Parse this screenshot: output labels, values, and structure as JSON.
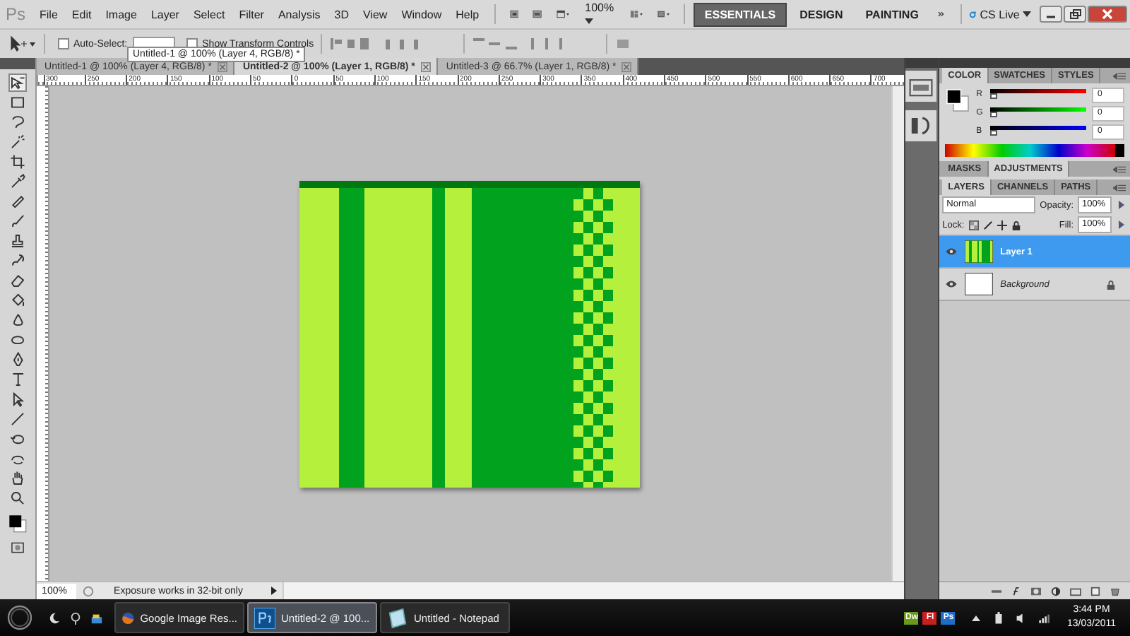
{
  "app": {
    "logo": "Ps",
    "menu": [
      "File",
      "Edit",
      "Image",
      "Layer",
      "Select",
      "Filter",
      "Analysis",
      "3D",
      "View",
      "Window",
      "Help"
    ],
    "zoom": "100%",
    "cs_live": "CS Live"
  },
  "workspaces": [
    {
      "label": "ESSENTIALS",
      "selected": true
    },
    {
      "label": "DESIGN",
      "selected": false
    },
    {
      "label": "PAINTING",
      "selected": false
    }
  ],
  "options_bar": {
    "auto_select": {
      "label": "Auto-Select:",
      "checked": false
    },
    "show_transform": {
      "label": "Show Transform Controls",
      "checked": false
    }
  },
  "tooltip": "Untitled-1 @ 100% (Layer 4, RGB/8) *",
  "doc_tabs": [
    {
      "label": "Untitled-1 @ 100% (Layer 4, RGB/8) *",
      "selected": false
    },
    {
      "label": "Untitled-2 @ 100% (Layer 1, RGB/8) *",
      "selected": true
    },
    {
      "label": "Untitled-3 @ 66.7% (Layer 1, RGB/8) *",
      "selected": false
    }
  ],
  "ruler": [
    "300",
    "250",
    "200",
    "150",
    "100",
    "50",
    "0",
    "50",
    "100",
    "150",
    "200",
    "250",
    "300",
    "350",
    "400",
    "450",
    "500",
    "550",
    "600",
    "650",
    "700"
  ],
  "status_bar": {
    "zoom": "100%",
    "message": "Exposure works in 32-bit only"
  },
  "color_panel": {
    "tabs": [
      {
        "label": "COLOR",
        "selected": true
      },
      {
        "label": "SWATCHES",
        "selected": false
      },
      {
        "label": "STYLES",
        "selected": false
      }
    ],
    "channels": [
      {
        "label": "R",
        "value": "0",
        "color": "#ff0000",
        "level": 0
      },
      {
        "label": "G",
        "value": "0",
        "color": "#00ff00",
        "level": 0
      },
      {
        "label": "B",
        "value": "0",
        "color": "#0000ff",
        "level": 0
      }
    ]
  },
  "adjust_tabs": [
    {
      "label": "MASKS",
      "selected": false
    },
    {
      "label": "ADJUSTMENTS",
      "selected": true
    }
  ],
  "layers_panel": {
    "tabs": [
      {
        "label": "LAYERS",
        "selected": true
      },
      {
        "label": "CHANNELS",
        "selected": false
      },
      {
        "label": "PATHS",
        "selected": false
      }
    ],
    "blend_mode": "Normal",
    "opacity_label": "Opacity:",
    "opacity": "100%",
    "lock_label": "Lock:",
    "fill_label": "Fill:",
    "fill": "100%",
    "layers": [
      {
        "name": "Layer 1",
        "selected": true,
        "visible": true,
        "locked": false,
        "kind": "stripes"
      },
      {
        "name": "Background",
        "selected": false,
        "visible": true,
        "locked": true,
        "kind": "white"
      }
    ]
  },
  "taskbar": {
    "items": [
      {
        "label": "Google Image Res...",
        "kind": "browser",
        "selected": false
      },
      {
        "label": "Untitled-2 @ 100...",
        "kind": "photoshop",
        "selected": true
      },
      {
        "label": "Untitled - Notepad",
        "kind": "notepad",
        "selected": false
      }
    ],
    "tray_apps": [
      {
        "label": "Dw",
        "color": "#6a9a1a"
      },
      {
        "label": "Fl",
        "color": "#c8201e"
      },
      {
        "label": "Ps",
        "color": "#1e6ec8"
      }
    ],
    "time": "3:44 PM",
    "date": "13/03/2011"
  }
}
